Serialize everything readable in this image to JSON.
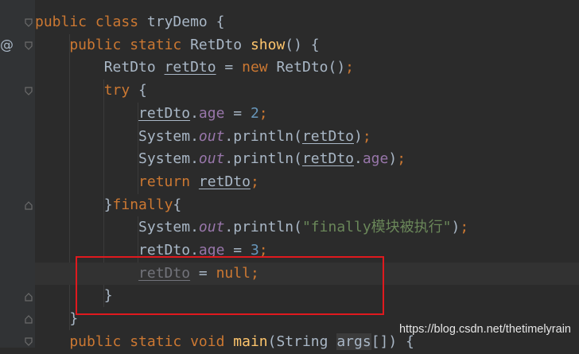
{
  "gutter": {
    "override_marker": "@"
  },
  "code_lines": [
    [
      {
        "t": "public ",
        "c": "t-kw"
      },
      {
        "t": "class ",
        "c": "t-kw"
      },
      {
        "t": "tryDemo ",
        "c": "t-id"
      },
      {
        "t": "{",
        "c": "t-punct"
      }
    ],
    [
      {
        "t": "    public ",
        "c": "t-kw"
      },
      {
        "t": "static ",
        "c": "t-kw"
      },
      {
        "t": "RetDto ",
        "c": "t-id"
      },
      {
        "t": "show",
        "c": "t-fn"
      },
      {
        "t": "() {",
        "c": "t-punct"
      }
    ],
    [
      {
        "t": "        RetDto ",
        "c": "t-id"
      },
      {
        "t": "retDto",
        "c": "t-var"
      },
      {
        "t": " = ",
        "c": "t-punct"
      },
      {
        "t": "new ",
        "c": "t-kw"
      },
      {
        "t": "RetDto()",
        "c": "t-id"
      },
      {
        "t": ";",
        "c": "t-semi"
      }
    ],
    [
      {
        "t": "        try ",
        "c": "t-kw"
      },
      {
        "t": "{",
        "c": "t-punct"
      }
    ],
    [
      {
        "t": "            ",
        "c": "t-punct"
      },
      {
        "t": "retDto",
        "c": "t-var"
      },
      {
        "t": ".",
        "c": "t-punct"
      },
      {
        "t": "age",
        "c": "t-field"
      },
      {
        "t": " = ",
        "c": "t-punct"
      },
      {
        "t": "2",
        "c": "t-num"
      },
      {
        "t": ";",
        "c": "t-semi"
      }
    ],
    [
      {
        "t": "            System.",
        "c": "t-id"
      },
      {
        "t": "out",
        "c": "t-static"
      },
      {
        "t": ".println(",
        "c": "t-id"
      },
      {
        "t": "retDto",
        "c": "t-var"
      },
      {
        "t": ")",
        "c": "t-punct"
      },
      {
        "t": ";",
        "c": "t-semi"
      }
    ],
    [
      {
        "t": "            System.",
        "c": "t-id"
      },
      {
        "t": "out",
        "c": "t-static"
      },
      {
        "t": ".println(",
        "c": "t-id"
      },
      {
        "t": "retDto",
        "c": "t-var"
      },
      {
        "t": ".",
        "c": "t-punct"
      },
      {
        "t": "age",
        "c": "t-field"
      },
      {
        "t": ")",
        "c": "t-punct"
      },
      {
        "t": ";",
        "c": "t-semi"
      }
    ],
    [
      {
        "t": "            return ",
        "c": "t-kw"
      },
      {
        "t": "retDto",
        "c": "t-var"
      },
      {
        "t": ";",
        "c": "t-semi"
      }
    ],
    [
      {
        "t": "        }",
        "c": "t-punct"
      },
      {
        "t": "finally",
        "c": "t-kw"
      },
      {
        "t": "{",
        "c": "t-punct"
      }
    ],
    [
      {
        "t": "            System.",
        "c": "t-id"
      },
      {
        "t": "out",
        "c": "t-static"
      },
      {
        "t": ".println(",
        "c": "t-id"
      },
      {
        "t": "\"finally模块被执行\"",
        "c": "t-str"
      },
      {
        "t": ")",
        "c": "t-punct"
      },
      {
        "t": ";",
        "c": "t-semi"
      }
    ],
    [
      {
        "t": "            ",
        "c": "t-punct"
      },
      {
        "t": "retDto",
        "c": "t-var"
      },
      {
        "t": ".",
        "c": "t-punct"
      },
      {
        "t": "age",
        "c": "t-field"
      },
      {
        "t": " = ",
        "c": "t-punct"
      },
      {
        "t": "3",
        "c": "t-num"
      },
      {
        "t": ";",
        "c": "t-semi"
      }
    ],
    [
      {
        "t": "            ",
        "c": "t-punct"
      },
      {
        "t": "retDto",
        "c": "t-dim"
      },
      {
        "t": " = ",
        "c": "t-punct"
      },
      {
        "t": "null",
        "c": "t-kw"
      },
      {
        "t": ";",
        "c": "t-semi"
      }
    ],
    [
      {
        "t": "        }",
        "c": "t-punct"
      }
    ],
    [
      {
        "t": "    }",
        "c": "t-punct"
      }
    ],
    [
      {
        "t": "    public ",
        "c": "t-kw"
      },
      {
        "t": "static ",
        "c": "t-kw"
      },
      {
        "t": "void ",
        "c": "t-kw"
      },
      {
        "t": "main",
        "c": "t-fn"
      },
      {
        "t": "(String ",
        "c": "t-id"
      },
      {
        "t": "args",
        "c": "t-param"
      },
      {
        "t": "[]) {",
        "c": "t-punct"
      }
    ]
  ],
  "watermark": "https://blog.csdn.net/thetimelyrain",
  "colors": {
    "background": "#2b2b2b",
    "keyword": "#cc7832",
    "function": "#ffc66d",
    "field": "#9876aa",
    "number": "#6897bb",
    "string": "#6a8759",
    "highlight_box": "#e0191e"
  }
}
